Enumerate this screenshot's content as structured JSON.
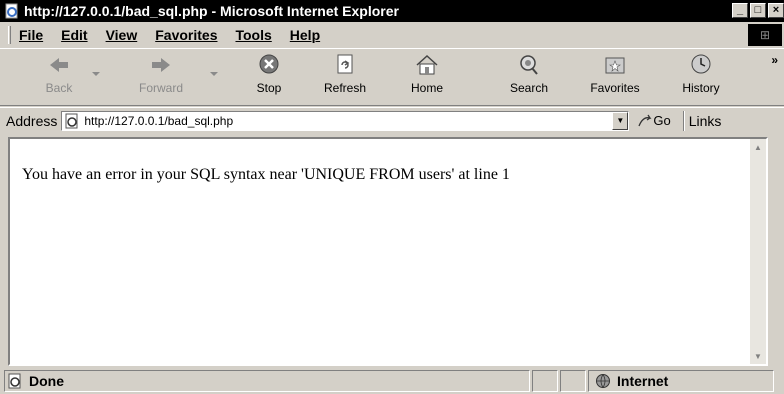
{
  "window": {
    "title": "http://127.0.0.1/bad_sql.php - Microsoft Internet Explorer"
  },
  "menu": [
    "File",
    "Edit",
    "View",
    "Favorites",
    "Tools",
    "Help"
  ],
  "toolbar": {
    "back": "Back",
    "forward": "Forward",
    "stop": "Stop",
    "refresh": "Refresh",
    "home": "Home",
    "search": "Search",
    "favorites": "Favorites",
    "history": "History",
    "more": "»"
  },
  "address": {
    "label": "Address",
    "url": "http://127.0.0.1/bad_sql.php",
    "go": "Go",
    "links": "Links"
  },
  "page": {
    "message": "You have an error in your SQL syntax near 'UNIQUE FROM users' at line 1"
  },
  "status": {
    "text": "Done",
    "zone": "Internet"
  },
  "icons": {
    "title": "ie-page-icon",
    "back": "back-arrow-icon",
    "forward": "forward-arrow-icon",
    "stop": "stop-icon",
    "refresh": "refresh-icon",
    "home": "home-icon",
    "search": "search-icon",
    "favorites": "favorites-icon",
    "history": "history-icon"
  }
}
